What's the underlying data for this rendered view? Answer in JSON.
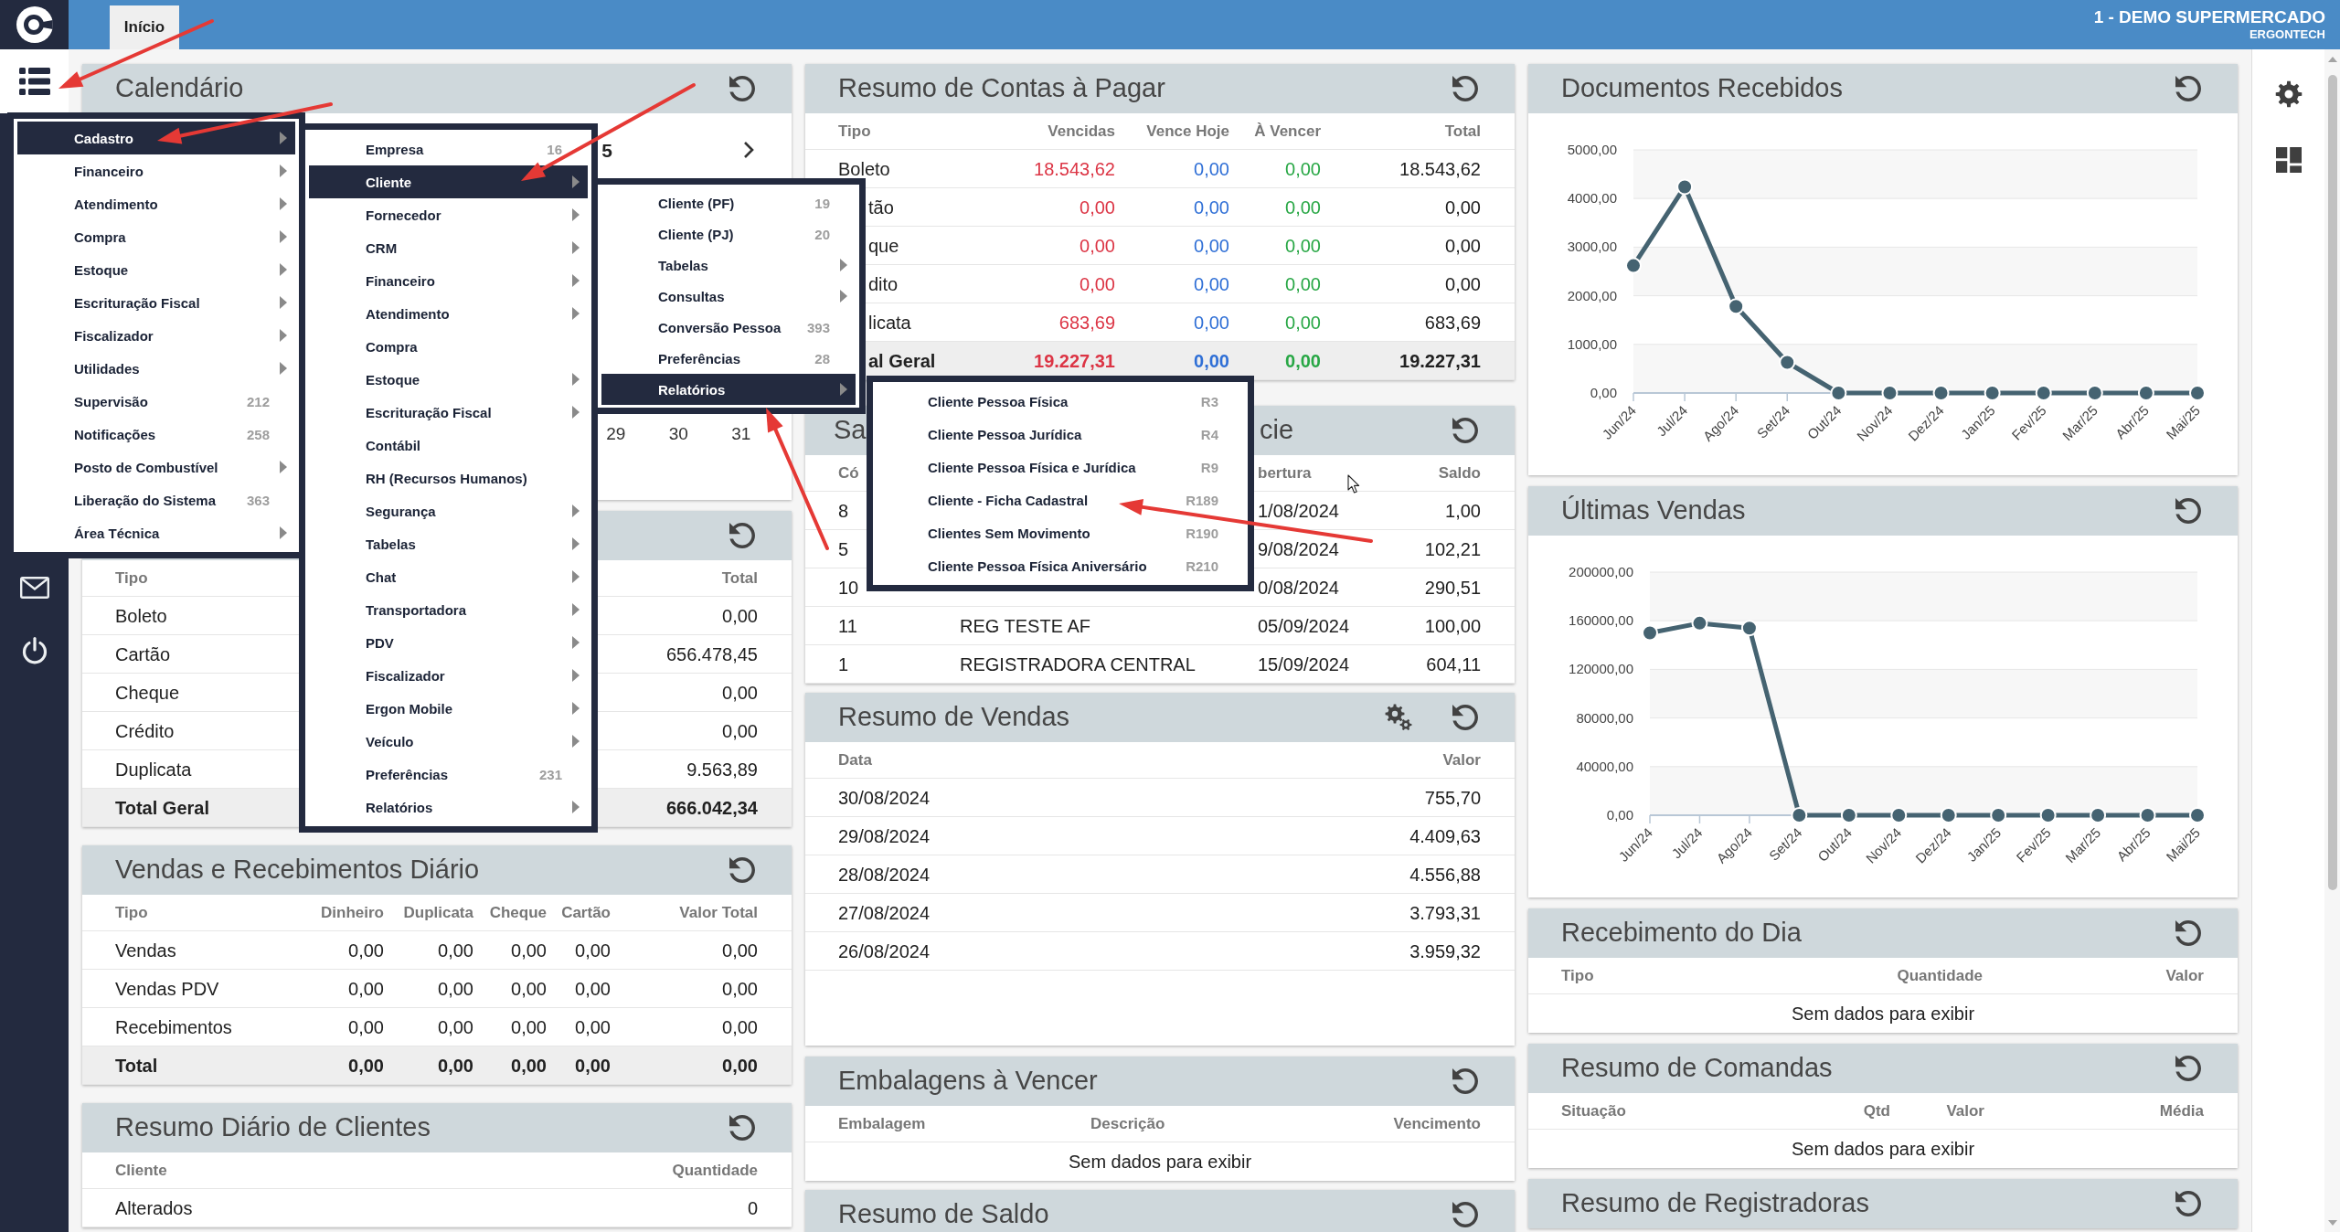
{
  "sidebar": {
    "buttons": [
      {
        "selected": true
      },
      {
        "selected": false
      },
      {
        "selected": false
      }
    ]
  },
  "topbar": {
    "tabs": [
      {
        "label": "Início",
        "selected": true
      }
    ],
    "company": "1 - DEMO SUPERMERCADO",
    "user": "ERGONTECH"
  },
  "dashboard": {
    "columns": [
      {
        "panels": [
          {
            "kind": "calendar",
            "title": "Calendário",
            "settings_button": false,
            "month_label": "5",
            "days": [
              "29",
              "30",
              "31"
            ]
          },
          {
            "kind": "table",
            "settings_button": false,
            "columns": [
              {
                "label": "Tipo"
              },
              {
                "label": "Total"
              }
            ],
            "rows": [
              {
                "kind": "data",
                "cells": [
                  "Boleto",
                  "0,00"
                ]
              },
              {
                "kind": "data",
                "cells": [
                  "Cartão",
                  "656.478,45"
                ]
              },
              {
                "kind": "data",
                "cells": [
                  "Cheque",
                  "0,00"
                ]
              },
              {
                "kind": "data",
                "cells": [
                  "Crédito",
                  "0,00"
                ]
              },
              {
                "kind": "data",
                "cells": [
                  "Duplicata",
                  "9.563,89"
                ]
              },
              {
                "kind": "total",
                "cells": [
                  "Total Geral",
                  "666.042,34"
                ]
              }
            ]
          },
          {
            "kind": "table",
            "title": "Vendas e Recebimentos Diário",
            "settings_button": false,
            "columns": [
              {
                "label": "Tipo"
              },
              {
                "label": "Dinheiro"
              },
              {
                "label": "Duplicata"
              },
              {
                "label": "Cheque"
              },
              {
                "label": "Cartão"
              },
              {
                "label": "Valor Total"
              }
            ],
            "rows": [
              {
                "kind": "data",
                "cells": [
                  "Vendas",
                  "0,00",
                  "0,00",
                  "0,00",
                  "0,00",
                  "0,00"
                ]
              },
              {
                "kind": "data",
                "cells": [
                  "Vendas PDV",
                  "0,00",
                  "0,00",
                  "0,00",
                  "0,00",
                  "0,00"
                ]
              },
              {
                "kind": "data",
                "cells": [
                  "Recebimentos",
                  "0,00",
                  "0,00",
                  "0,00",
                  "0,00",
                  "0,00"
                ]
              },
              {
                "kind": "total",
                "cells": [
                  "Total",
                  "0,00",
                  "0,00",
                  "0,00",
                  "0,00",
                  "0,00"
                ]
              }
            ]
          },
          {
            "kind": "table",
            "title": "Resumo Diário de Clientes",
            "settings_button": false,
            "columns": [
              {
                "label": "Cliente"
              },
              {
                "label": "Quantidade"
              }
            ],
            "rows": [
              {
                "kind": "data",
                "cells": [
                  "Alterados",
                  "0"
                ]
              }
            ]
          }
        ]
      },
      {
        "panels": [
          {
            "kind": "table",
            "title": "Resumo de Contas à Pagar",
            "settings_button": false,
            "columns": [
              {
                "label": "Tipo"
              },
              {
                "label": "Vencidas",
                "color": "#dc3545"
              },
              {
                "label": "Vence Hoje",
                "color": "#2f6fd6"
              },
              {
                "label": "À Vencer",
                "color": "#28a745"
              },
              {
                "label": "Total"
              }
            ],
            "rows": [
              {
                "kind": "data",
                "cells": [
                  "Boleto",
                  "18.543,62",
                  "0,00",
                  "0,00",
                  "18.543,62"
                ]
              },
              {
                "kind": "data",
                "cells": [
                  "tão",
                  "0,00",
                  "0,00",
                  "0,00",
                  "0,00"
                ]
              },
              {
                "kind": "data",
                "cells": [
                  "que",
                  "0,00",
                  "0,00",
                  "0,00",
                  "0,00"
                ]
              },
              {
                "kind": "data",
                "cells": [
                  "dito",
                  "0,00",
                  "0,00",
                  "0,00",
                  "0,00"
                ]
              },
              {
                "kind": "data",
                "cells": [
                  "licata",
                  "683,69",
                  "0,00",
                  "0,00",
                  "683,69"
                ]
              },
              {
                "kind": "total",
                "cells": [
                  "al Geral",
                  "19.227,31",
                  "0,00",
                  "0,00",
                  "19.227,31"
                ]
              }
            ]
          },
          {
            "kind": "table",
            "title_fragments": [
              "Sa",
              "cie"
            ],
            "settings_button": false,
            "columns": [
              {
                "label": "Có"
              },
              {
                "label": "bertura"
              },
              {
                "label": "Saldo"
              }
            ],
            "rows": [
              {
                "kind": "data",
                "cells": [
                  "8",
                  "1/08/2024",
                  "1,00"
                ]
              },
              {
                "kind": "data",
                "cells": [
                  "5",
                  "9/08/2024",
                  "102,21"
                ]
              },
              {
                "kind": "data",
                "cells": [
                  "10",
                  "0/08/2024",
                  "290,51"
                ]
              },
              {
                "kind": "data",
                "cells": [
                  "11",
                  "REG TESTE AF",
                  "05/09/2024",
                  "100,00"
                ]
              },
              {
                "kind": "data",
                "cells": [
                  "1",
                  "REGISTRADORA CENTRAL",
                  "15/09/2024",
                  "604,11"
                ]
              }
            ]
          },
          {
            "kind": "table",
            "title": "Resumo de Vendas",
            "settings_button": true,
            "columns": [
              {
                "label": "Data"
              },
              {
                "label": "Valor"
              }
            ],
            "rows": [
              {
                "kind": "data",
                "cells": [
                  "30/08/2024",
                  "755,70"
                ]
              },
              {
                "kind": "data",
                "cells": [
                  "29/08/2024",
                  "4.409,63"
                ]
              },
              {
                "kind": "data",
                "cells": [
                  "28/08/2024",
                  "4.556,88"
                ]
              },
              {
                "kind": "data",
                "cells": [
                  "27/08/2024",
                  "3.793,31"
                ]
              },
              {
                "kind": "data",
                "cells": [
                  "26/08/2024",
                  "3.959,32"
                ]
              }
            ]
          },
          {
            "kind": "table",
            "title": "Embalagens à Vencer",
            "settings_button": false,
            "columns": [
              {
                "label": "Embalagem"
              },
              {
                "label": "Descrição"
              },
              {
                "label": "Vencimento"
              }
            ],
            "empty_text": "Sem dados para exibir"
          },
          {
            "kind": "table",
            "title": "Resumo de Saldo",
            "settings_button": false
          }
        ]
      },
      {
        "panels": [
          {
            "kind": "chart",
            "title": "Documentos Recebidos",
            "settings_button": false,
            "chart_data": {
              "type": "line",
              "grid": true,
              "categories": [
                "Jun/24",
                "Jul/24",
                "Ago/24",
                "Set/24",
                "Out/24",
                "Nov/24",
                "Dez/24",
                "Jan/25",
                "Fev/25",
                "Mar/25",
                "Abr/25",
                "Mai/25"
              ],
              "series": [
                {
                  "color": "#456371",
                  "marker": "circle",
                  "values": [
                    2620,
                    4240,
                    1780,
                    630,
                    0,
                    0,
                    0,
                    0,
                    0,
                    0,
                    0,
                    0
                  ]
                }
              ],
              "ylim": [
                0,
                5000
              ],
              "yticks": [
                {
                  "value": 0,
                  "label": "0,00"
                },
                {
                  "value": 1000,
                  "label": "1000,00"
                },
                {
                  "value": 2000,
                  "label": "2000,00"
                },
                {
                  "value": 3000,
                  "label": "3000,00"
                },
                {
                  "value": 4000,
                  "label": "4000,00"
                },
                {
                  "value": 5000,
                  "label": "5000,00"
                }
              ]
            }
          },
          {
            "kind": "chart",
            "title": "Últimas Vendas",
            "settings_button": false,
            "chart_data": {
              "type": "line",
              "grid": true,
              "categories": [
                "Jun/24",
                "Jul/24",
                "Ago/24",
                "Set/24",
                "Out/24",
                "Nov/24",
                "Dez/24",
                "Jan/25",
                "Fev/25",
                "Mar/25",
                "Abr/25",
                "Mai/25"
              ],
              "series": [
                {
                  "color": "#456371",
                  "marker": "circle",
                  "values": [
                    150000,
                    158000,
                    154000,
                    0,
                    0,
                    0,
                    0,
                    0,
                    0,
                    0,
                    0,
                    0
                  ]
                }
              ],
              "ylim": [
                0,
                200000
              ],
              "yticks": [
                {
                  "value": 0,
                  "label": "0,00"
                },
                {
                  "value": 40000,
                  "label": "40000,00"
                },
                {
                  "value": 80000,
                  "label": "80000,00"
                },
                {
                  "value": 120000,
                  "label": "120000,00"
                },
                {
                  "value": 160000,
                  "label": "160000,00"
                },
                {
                  "value": 200000,
                  "label": "200000,00"
                }
              ]
            }
          },
          {
            "kind": "table",
            "title": "Recebimento do Dia",
            "settings_button": false,
            "columns": [
              {
                "label": "Tipo"
              },
              {
                "label": "Quantidade"
              },
              {
                "label": "Valor"
              }
            ],
            "empty_text": "Sem dados para exibir"
          },
          {
            "kind": "table",
            "title": "Resumo de Comandas",
            "settings_button": false,
            "columns": [
              {
                "label": "Situação"
              },
              {
                "label": "Qtd"
              },
              {
                "label": "Valor"
              },
              {
                "label": "Média"
              }
            ],
            "empty_text": "Sem dados para exibir"
          },
          {
            "kind": "table",
            "title": "Resumo de Registradoras",
            "settings_button": false
          }
        ]
      }
    ]
  },
  "menus": [
    {
      "items": [
        {
          "label": "Cadastro",
          "has_submenu": true,
          "selected": true
        },
        {
          "label": "Financeiro",
          "has_submenu": true,
          "selected": false
        },
        {
          "label": "Atendimento",
          "has_submenu": true,
          "selected": false
        },
        {
          "label": "Compra",
          "has_submenu": true,
          "selected": false
        },
        {
          "label": "Estoque",
          "has_submenu": true,
          "selected": false
        },
        {
          "label": "Escrituração Fiscal",
          "has_submenu": true,
          "selected": false
        },
        {
          "label": "Fiscalizador",
          "has_submenu": true,
          "selected": false
        },
        {
          "label": "Utilidades",
          "has_submenu": true,
          "selected": false
        },
        {
          "label": "Supervisão",
          "count": "212",
          "has_submenu": false,
          "selected": false
        },
        {
          "label": "Notificações",
          "count": "258",
          "has_submenu": false,
          "selected": false
        },
        {
          "label": "Posto de Combustível",
          "has_submenu": true,
          "selected": false
        },
        {
          "label": "Liberação do Sistema",
          "count": "363",
          "has_submenu": false,
          "selected": false
        },
        {
          "label": "Área Técnica",
          "has_submenu": true,
          "selected": false
        }
      ]
    },
    {
      "items": [
        {
          "label": "Empresa",
          "count": "16",
          "has_submenu": false,
          "selected": false
        },
        {
          "label": "Cliente",
          "has_submenu": true,
          "selected": true
        },
        {
          "label": "Fornecedor",
          "has_submenu": true,
          "selected": false
        },
        {
          "label": "CRM",
          "has_submenu": true,
          "selected": false
        },
        {
          "label": "Financeiro",
          "has_submenu": true,
          "selected": false
        },
        {
          "label": "Atendimento",
          "has_submenu": true,
          "selected": false
        },
        {
          "label": "Compra",
          "has_submenu": false,
          "selected": false
        },
        {
          "label": "Estoque",
          "has_submenu": true,
          "selected": false
        },
        {
          "label": "Escrituração Fiscal",
          "has_submenu": true,
          "selected": false
        },
        {
          "label": "Contábil",
          "has_submenu": false,
          "selected": false
        },
        {
          "label": "RH (Recursos Humanos)",
          "has_submenu": false,
          "selected": false
        },
        {
          "label": "Segurança",
          "has_submenu": true,
          "selected": false
        },
        {
          "label": "Tabelas",
          "has_submenu": true,
          "selected": false
        },
        {
          "label": "Chat",
          "has_submenu": true,
          "selected": false
        },
        {
          "label": "Transportadora",
          "has_submenu": true,
          "selected": false
        },
        {
          "label": "PDV",
          "has_submenu": true,
          "selected": false
        },
        {
          "label": "Fiscalizador",
          "has_submenu": true,
          "selected": false
        },
        {
          "label": "Ergon Mobile",
          "has_submenu": true,
          "selected": false
        },
        {
          "label": "Veículo",
          "has_submenu": true,
          "selected": false
        },
        {
          "label": "Preferências",
          "count": "231",
          "has_submenu": false,
          "selected": false
        },
        {
          "label": "Relatórios",
          "has_submenu": true,
          "selected": false
        }
      ]
    },
    {
      "items": [
        {
          "label": "Cliente (PF)",
          "count": "19",
          "has_submenu": false,
          "selected": false
        },
        {
          "label": "Cliente (PJ)",
          "count": "20",
          "has_submenu": false,
          "selected": false
        },
        {
          "label": "Tabelas",
          "has_submenu": true,
          "selected": false
        },
        {
          "label": "Consultas",
          "has_submenu": true,
          "selected": false
        },
        {
          "label": "Conversão Pessoa",
          "count": "393",
          "has_submenu": false,
          "selected": false
        },
        {
          "label": "Preferências",
          "count": "28",
          "has_submenu": false,
          "selected": false
        },
        {
          "label": "Relatórios",
          "has_submenu": true,
          "selected": true
        }
      ]
    },
    {
      "items": [
        {
          "label": "Cliente Pessoa Física",
          "count": "R3",
          "has_submenu": false,
          "selected": false
        },
        {
          "label": "Cliente Pessoa Jurídica",
          "count": "R4",
          "has_submenu": false,
          "selected": false
        },
        {
          "label": "Cliente Pessoa Física e Jurídica",
          "count": "R9",
          "has_submenu": false,
          "selected": false
        },
        {
          "label": "Cliente - Ficha Cadastral",
          "count": "R189",
          "has_submenu": false,
          "selected": false
        },
        {
          "label": "Clientes Sem Movimento",
          "count": "R190",
          "has_submenu": false,
          "selected": false
        },
        {
          "label": "Cliente Pessoa Física Aniversário",
          "count": "R210",
          "has_submenu": false,
          "selected": false
        }
      ]
    }
  ]
}
